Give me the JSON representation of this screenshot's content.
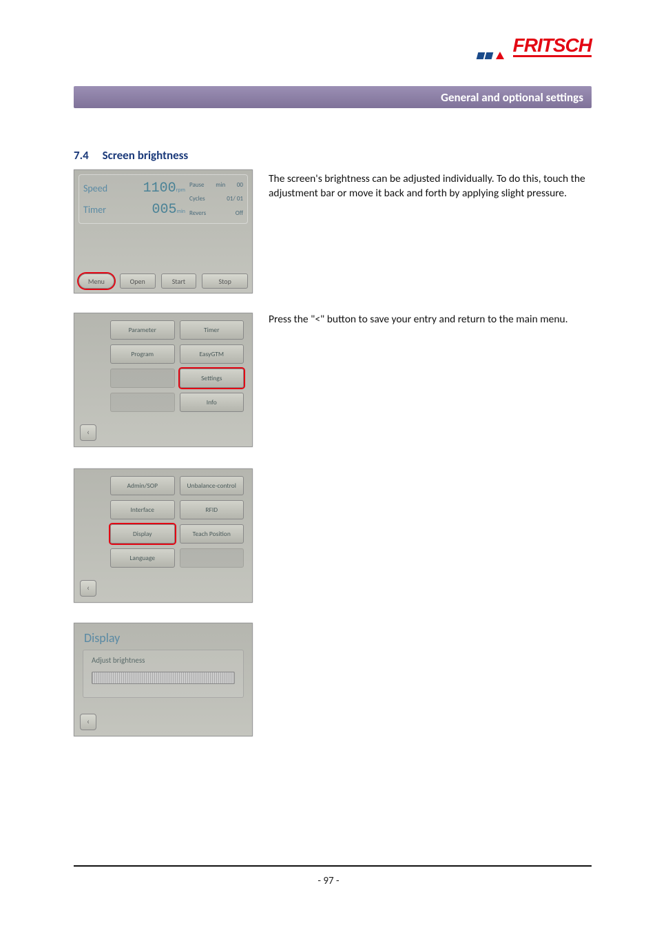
{
  "logo": {
    "text": "FRITSCH"
  },
  "header_band": "General and optional settings",
  "section": {
    "number": "7.4",
    "title": "Screen brightness"
  },
  "paragraph1": "The screen's brightness can be adjusted individually. To do this, touch the adjustment bar or move it back and forth by applying slight pressure.",
  "paragraph2": "Press the \"<\" button to save your entry and return to the main menu.",
  "shot1": {
    "speed_label": "Speed",
    "timer_label": "Timer",
    "speed_value": "1100",
    "speed_unit": "rpm",
    "timer_value": "005",
    "timer_unit": "min",
    "pause_label": "Pause",
    "pause_unit": "min",
    "pause_value": "00",
    "cycles_label": "Cycles",
    "cycles_value": "01/ 01",
    "revers_label": "Revers",
    "revers_value": "Off",
    "btn_menu": "Menu",
    "btn_open": "Open",
    "btn_start": "Start",
    "btn_stop": "Stop"
  },
  "shot2": {
    "items": [
      "Parameter",
      "Timer",
      "Program",
      "EasyGTM",
      "",
      "Settings",
      "",
      "Info"
    ],
    "back": "‹"
  },
  "shot3": {
    "items": [
      "Admin/SOP",
      "Unbalance-control",
      "Interface",
      "RFID",
      "Display",
      "Teach Position",
      "Language",
      ""
    ],
    "back": "‹"
  },
  "shot4": {
    "title": "Display",
    "label": "Adjust brightness",
    "back": "‹"
  },
  "page_number": "- 97 -",
  "highlights": {
    "shot1_highlight": "Menu",
    "shot2_highlight": "Settings",
    "shot3_highlight": "Display"
  }
}
